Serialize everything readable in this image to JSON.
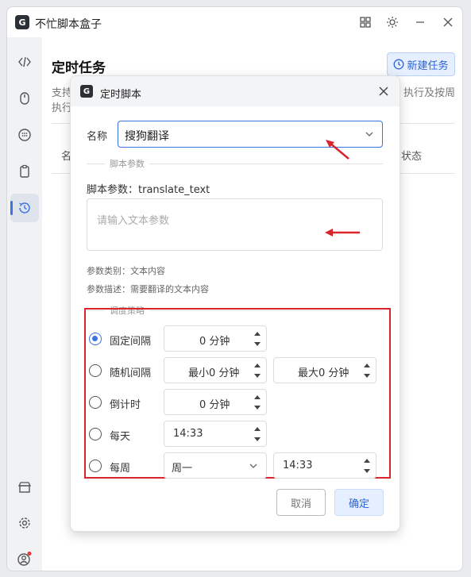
{
  "app": {
    "title": "不忙脚本盒子"
  },
  "main": {
    "page_title": "定时任务",
    "new_task_label": "新建任务",
    "desc_left_1": "支持",
    "desc_right_1": "执行及按周",
    "desc_left_2": "执行",
    "col_name": "名",
    "col_status": "状态"
  },
  "dialog": {
    "title": "定时脚本",
    "name_label": "名称",
    "name_value": "搜狗翻译",
    "params_section": "脚本参数",
    "params_label": "脚本参数：translate_text",
    "params_placeholder": "请输入文本参数",
    "param_type": "参数类别：文本内容",
    "param_desc": "参数描述：需要翻译的文本内容",
    "schedule_section": "调度策略",
    "options": [
      {
        "label": "固定间隔",
        "checked": true,
        "value": "0 分钟"
      },
      {
        "label": "随机间隔",
        "checked": false,
        "min": "最小0 分钟",
        "max": "最大0 分钟"
      },
      {
        "label": "倒计时",
        "checked": false,
        "value": "0 分钟"
      },
      {
        "label": "每天",
        "checked": false,
        "value": "14:33"
      },
      {
        "label": "每周",
        "checked": false,
        "weekday": "周一",
        "time": "14:33"
      }
    ],
    "cancel_label": "取消",
    "ok_label": "确定"
  },
  "colors": {
    "accent": "#3a74e0",
    "annotation": "#d9262d"
  }
}
